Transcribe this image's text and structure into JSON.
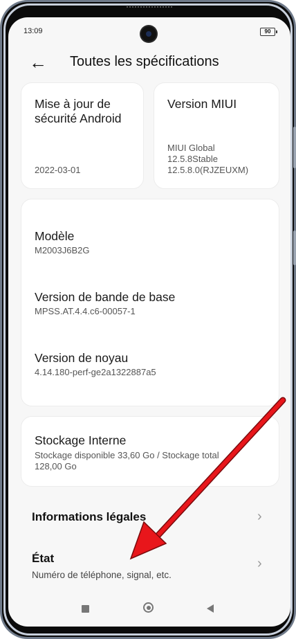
{
  "status_bar": {
    "time": "13:09",
    "battery": "90"
  },
  "header": {
    "title": "Toutes les spécifications"
  },
  "cards": {
    "security": {
      "title": "Mise à jour de sécurité Android",
      "value": "2022-03-01"
    },
    "miui": {
      "title": "Version MIUI",
      "line1": "MIUI Global",
      "line2": "12.5.8Stable",
      "line3": "12.5.8.0(RJZEUXM)"
    }
  },
  "details": [
    {
      "label": "Modèle",
      "value": "M2003J6B2G"
    },
    {
      "label": "Version de bande de base",
      "value": "MPSS.AT.4.4.c6-00057-1"
    },
    {
      "label": "Version de noyau",
      "value": "4.14.180-perf-ge2a1322887a5"
    }
  ],
  "storage": {
    "title": "Stockage Interne",
    "line1": "Stockage disponible  33,60 Go / Stockage total",
    "line2": "128,00 Go"
  },
  "menu": [
    {
      "title": "Informations légales",
      "subtitle": ""
    },
    {
      "title": "État",
      "subtitle": "Numéro de téléphone, signal, etc."
    }
  ],
  "colors": {
    "annotation_arrow": "#e8161b",
    "background": "#f7f7f7",
    "card": "#ffffff"
  }
}
